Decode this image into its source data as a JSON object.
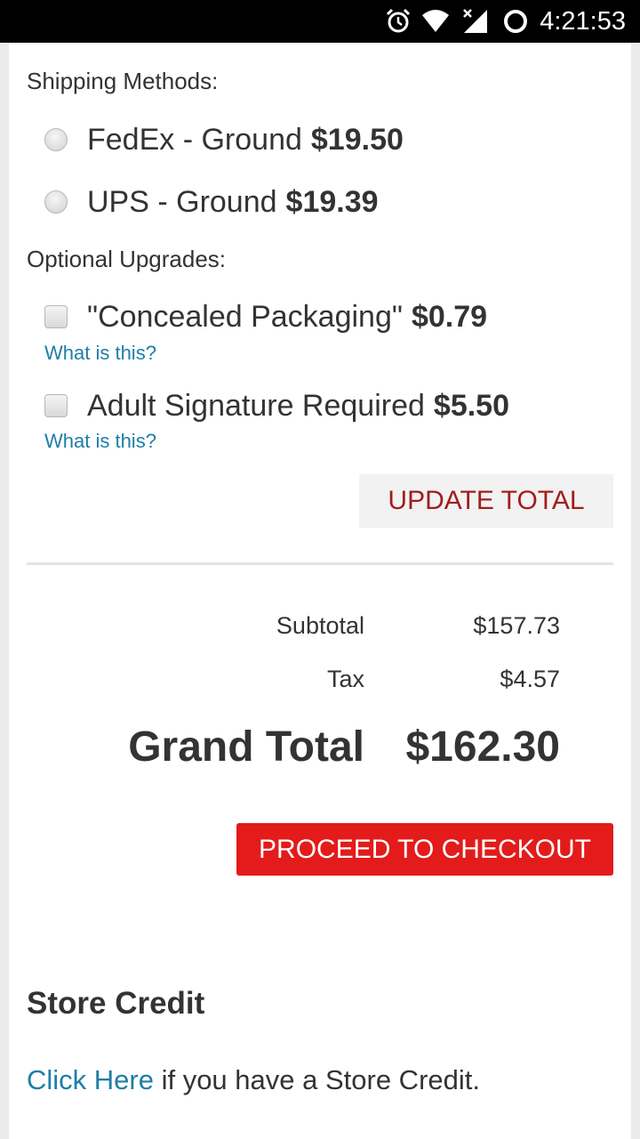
{
  "status_bar": {
    "time": "4:21:53",
    "icons": [
      "alarm-icon",
      "wifi-icon",
      "signal-icon",
      "sync-icon"
    ]
  },
  "shipping": {
    "label": "Shipping Methods:",
    "options": [
      {
        "name": "FedEx - Ground",
        "price": "$19.50",
        "selected": false
      },
      {
        "name": "UPS - Ground",
        "price": "$19.39",
        "selected": false
      }
    ]
  },
  "upgrades": {
    "label": "Optional Upgrades:",
    "options": [
      {
        "name": "\"Concealed Packaging\"",
        "price": "$0.79",
        "checked": false,
        "help": "What is this?"
      },
      {
        "name": "Adult Signature Required",
        "price": "$5.50",
        "checked": false,
        "help": "What is this?"
      }
    ]
  },
  "update_button": "UPDATE TOTAL",
  "totals": {
    "subtotal_label": "Subtotal",
    "subtotal_value": "$157.73",
    "tax_label": "Tax",
    "tax_value": "$4.57",
    "grand_label": "Grand Total",
    "grand_value": "$162.30"
  },
  "checkout_button": "PROCEED TO CHECKOUT",
  "store_credit": {
    "title": "Store Credit",
    "link_text": "Click Here",
    "text": " if you have a Store Credit."
  },
  "colors": {
    "accent_red": "#e31b1b",
    "update_text": "#a21d1d",
    "link_blue": "#1e7ea7"
  }
}
